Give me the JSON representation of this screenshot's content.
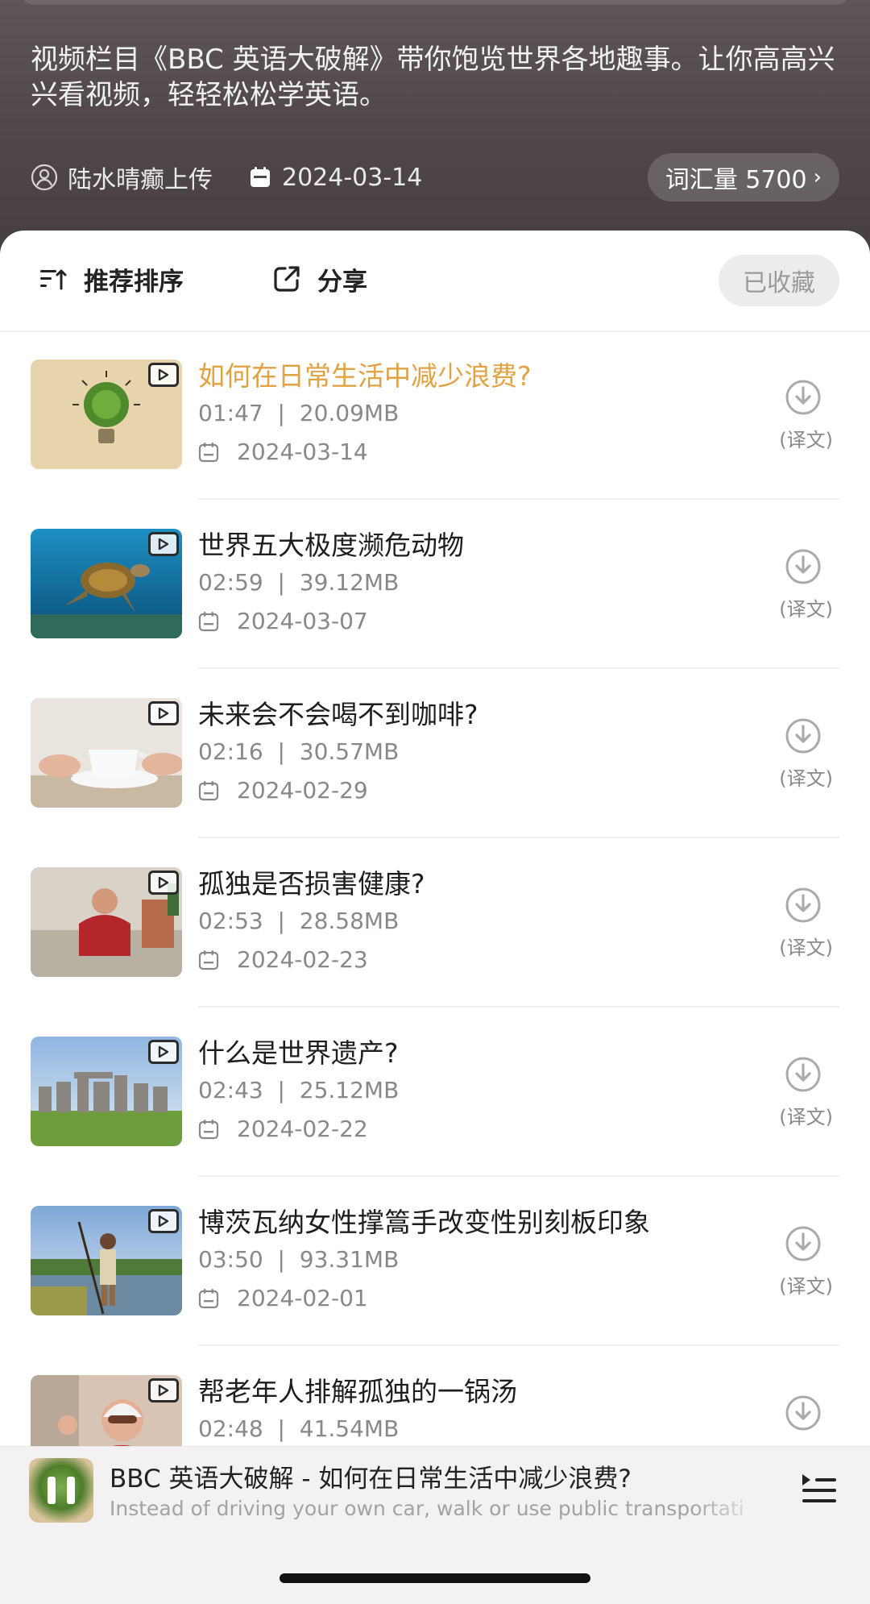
{
  "header": {
    "description": "视频栏目《BBC 英语大破解》带你饱览世界各地趣事。让你高高兴兴看视频，轻轻松松学英语。",
    "uploader": "陆水晴癫上传",
    "date": "2024-03-14",
    "vocab_label": "词汇量 5700",
    "vocab_icon": "chevron-right-icon"
  },
  "toolbar": {
    "sort_label": "推荐排序",
    "share_label": "分享",
    "favorite_label": "已收藏"
  },
  "episodes": [
    {
      "title": "如何在日常生活中减少浪费?",
      "duration": "01:47",
      "size": "20.09MB",
      "date": "2024-03-14",
      "translation": "(译文)",
      "active": true,
      "thumb": "lightbulb-leaf"
    },
    {
      "title": "世界五大极度濒危动物",
      "duration": "02:59",
      "size": "39.12MB",
      "date": "2024-03-07",
      "translation": "(译文)",
      "active": false,
      "thumb": "sea-turtle"
    },
    {
      "title": "未来会不会喝不到咖啡?",
      "duration": "02:16",
      "size": "30.57MB",
      "date": "2024-02-29",
      "translation": "(译文)",
      "active": false,
      "thumb": "coffee-cup"
    },
    {
      "title": "孤独是否损害健康?",
      "duration": "02:53",
      "size": "28.58MB",
      "date": "2024-02-23",
      "translation": "(译文)",
      "active": false,
      "thumb": "man-on-sofa"
    },
    {
      "title": "什么是世界遗产?",
      "duration": "02:43",
      "size": "25.12MB",
      "date": "2024-02-22",
      "translation": "(译文)",
      "active": false,
      "thumb": "stonehenge"
    },
    {
      "title": "博茨瓦纳女性撑篙手改变性别刻板印象",
      "duration": "03:50",
      "size": "93.31MB",
      "date": "2024-02-01",
      "translation": "(译文)",
      "active": false,
      "thumb": "river-poler"
    },
    {
      "title": "帮老年人排解孤独的一锅汤",
      "duration": "02:48",
      "size": "41.54MB",
      "date": "",
      "translation": "",
      "active": false,
      "thumb": "elderly-man"
    }
  ],
  "player": {
    "title": "BBC 英语大破解 - 如何在日常生活中减少浪费?",
    "subtitle": "Instead of driving your own car, walk or use public transportati",
    "state": "pause-icon"
  },
  "colors": {
    "accent": "#e0a243",
    "hero_bg": "#4e4648",
    "text": "#1e1e1e",
    "muted": "#888888"
  }
}
